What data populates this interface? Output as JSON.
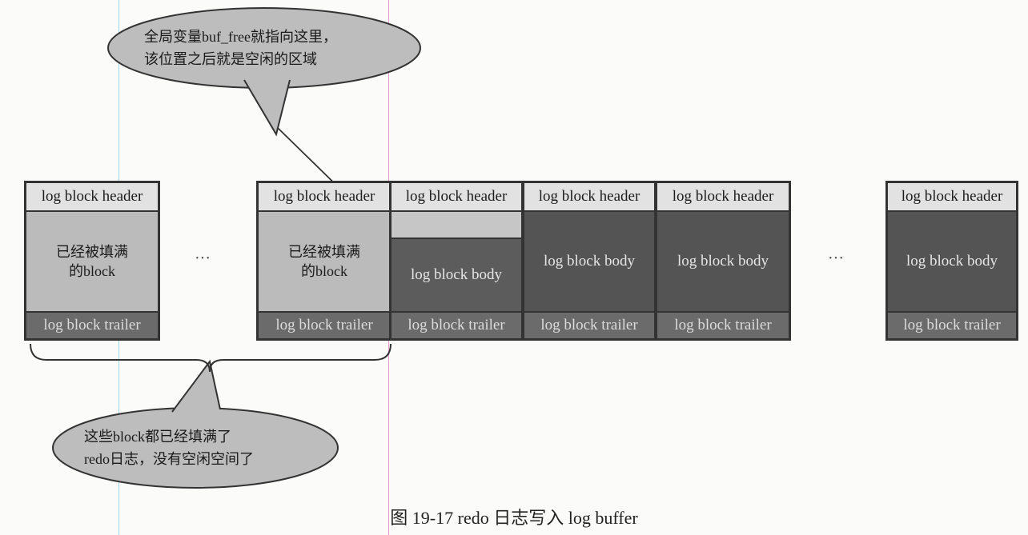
{
  "labels": {
    "header": "log block header",
    "body": "log block body",
    "trailer": "log block trailer",
    "filled_line1": "已经被填满",
    "filled_line2": "的block",
    "ellipsis": "···"
  },
  "callouts": {
    "top_line1": "全局变量buf_free就指向这里，",
    "top_line2": "该位置之后就是空闲的区域",
    "bottom_line1": "这些block都已经填满了",
    "bottom_line2": "redo日志，没有空闲空间了"
  },
  "caption": "图 19-17   redo 日志写入 log buffer"
}
